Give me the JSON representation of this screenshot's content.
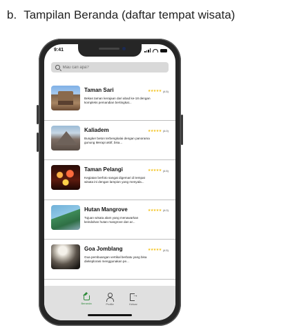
{
  "caption": {
    "letter": "b.",
    "text": "Tampilan Beranda (daftar tempat wisata)"
  },
  "status": {
    "time": "9:41"
  },
  "search": {
    "placeholder": "Mau cari apa?"
  },
  "places": [
    {
      "name": "Taman Sari",
      "rating": "(4.5)",
      "stars": "★★★★★",
      "description": "Bekas taman kerajaan dari abad ke-18 dengan kompleks pemandian bertingkat..."
    },
    {
      "name": "Kaliadem",
      "rating": "(4.0)",
      "stars": "★★★★★",
      "description": "Bungker beton terbengkalai dengan panorama gunung Merapi aktif, bisa..."
    },
    {
      "name": "Taman Pelangi",
      "rating": "(4.5)",
      "stars": "★★★★★",
      "description": "Kegiatan berfoto sangat digemari di tempat wisata ini dengan lampion yang menyala..."
    },
    {
      "name": "Hutan Mangrove",
      "rating": "(4.0)",
      "stars": "★★★★★",
      "description": "Tujuan wisata alam yang menawarkan keindahan hutan mangrove dan ar..."
    },
    {
      "name": "Goa Jomblang",
      "rating": "(4.5)",
      "stars": "★★★★★",
      "description": "Gua pembuangan vertikal berbatu yang bisa dieksplorasi menggunakan pe..."
    }
  ],
  "tabs": [
    {
      "label": "Beranda",
      "icon": "home-icon",
      "active": true
    },
    {
      "label": "Profile",
      "icon": "user-icon",
      "active": false
    },
    {
      "label": "Keluar",
      "icon": "logout-icon",
      "active": false
    }
  ],
  "colors": {
    "accent": "#2e8b3a",
    "star": "#f4c21a",
    "tabbar": "#e0e0e0",
    "search_bg": "#d9d9d9"
  }
}
